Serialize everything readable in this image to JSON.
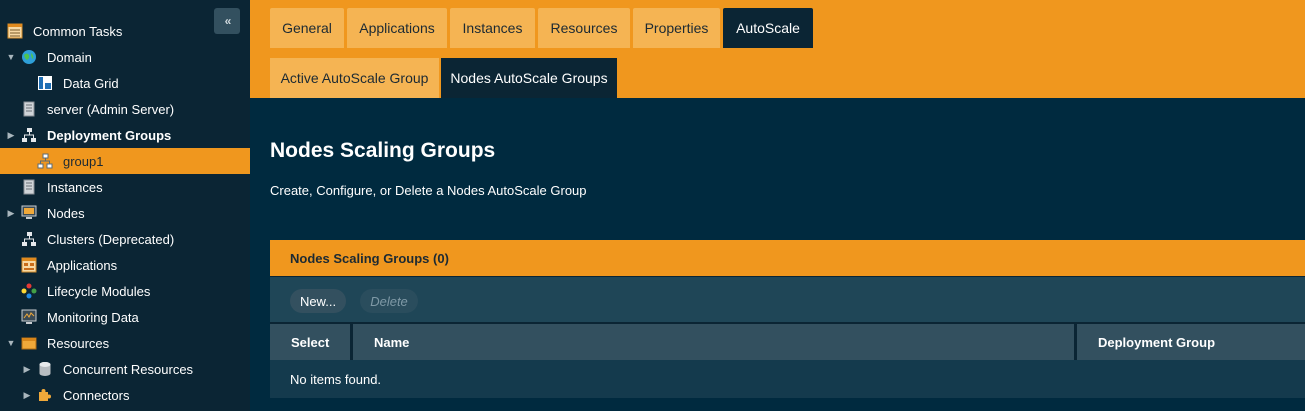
{
  "sidebar": {
    "collapse_glyph": "«",
    "items": [
      {
        "label": "Common Tasks",
        "icon": "common-tasks-icon",
        "toggle": ""
      },
      {
        "label": "Domain",
        "icon": "globe-icon",
        "toggle": "▼"
      },
      {
        "label": "Data Grid",
        "icon": "data-grid-icon",
        "toggle": ""
      },
      {
        "label": "server (Admin Server)",
        "icon": "server-icon",
        "toggle": ""
      },
      {
        "label": "Deployment Groups",
        "icon": "deployment-groups-icon",
        "toggle": "▶"
      },
      {
        "label": "group1",
        "icon": "group-icon",
        "toggle": ""
      },
      {
        "label": "Instances",
        "icon": "instances-icon",
        "toggle": ""
      },
      {
        "label": "Nodes",
        "icon": "nodes-icon",
        "toggle": "▶"
      },
      {
        "label": "Clusters (Deprecated)",
        "icon": "clusters-icon",
        "toggle": ""
      },
      {
        "label": "Applications",
        "icon": "applications-icon",
        "toggle": ""
      },
      {
        "label": "Lifecycle Modules",
        "icon": "lifecycle-icon",
        "toggle": ""
      },
      {
        "label": "Monitoring Data",
        "icon": "monitoring-icon",
        "toggle": ""
      },
      {
        "label": "Resources",
        "icon": "resources-icon",
        "toggle": "▼"
      },
      {
        "label": "Concurrent Resources",
        "icon": "database-icon",
        "toggle": "▶"
      },
      {
        "label": "Connectors",
        "icon": "connector-icon",
        "toggle": "▶"
      }
    ]
  },
  "tabs": [
    {
      "label": "General"
    },
    {
      "label": "Applications"
    },
    {
      "label": "Instances"
    },
    {
      "label": "Resources"
    },
    {
      "label": "Properties"
    },
    {
      "label": "AutoScale"
    }
  ],
  "subtabs": [
    {
      "label": "Active AutoScale Group"
    },
    {
      "label": "Nodes AutoScale Groups"
    }
  ],
  "page": {
    "title": "Nodes Scaling Groups",
    "help": "Create, Configure, or Delete a Nodes AutoScale Group"
  },
  "table": {
    "title": "Nodes Scaling Groups (0)",
    "new_label": "New...",
    "delete_label": "Delete",
    "columns": [
      "Select",
      "Name",
      "Deployment Group"
    ],
    "empty_message": "No items found."
  },
  "colors": {
    "accent": "#f0971e",
    "sidebar_bg": "#0b2534",
    "main_bg": "#002a3f"
  }
}
